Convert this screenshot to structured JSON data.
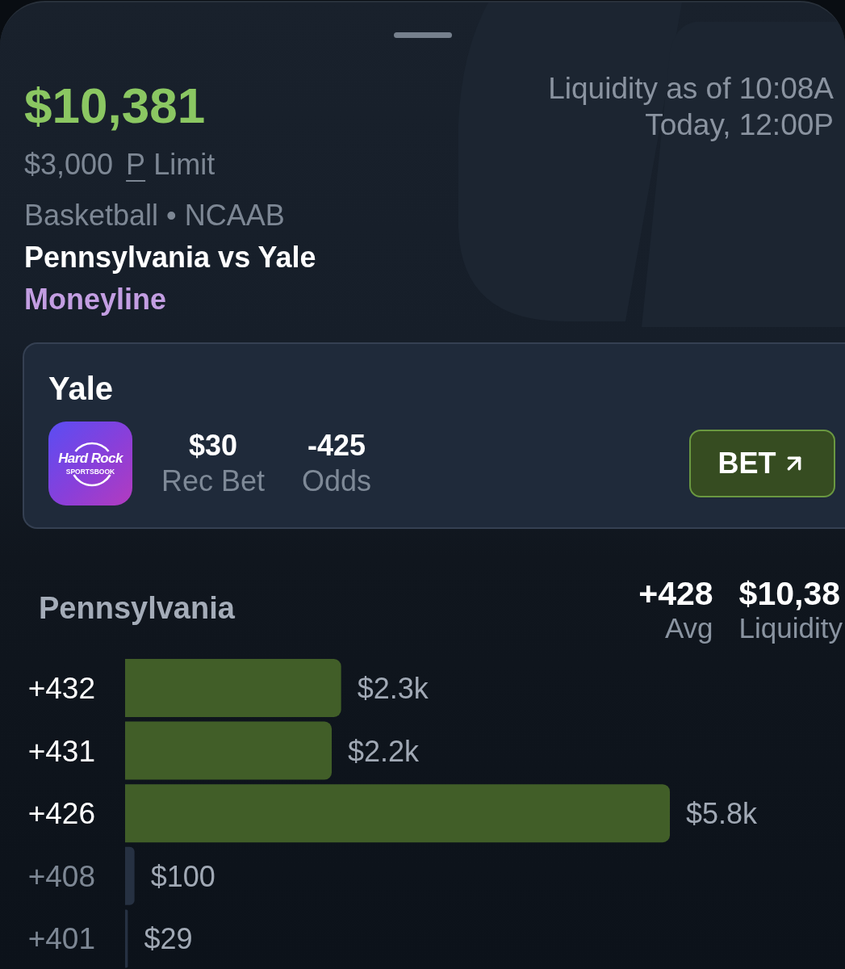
{
  "summary": {
    "total_liquidity": "$10,381",
    "limit": {
      "amount": "$3,000",
      "book_letter": "P",
      "label": "Limit"
    },
    "sport_league": "Basketball • NCAAB",
    "matchup": "Pennsylvania vs Yale",
    "market": "Moneyline",
    "updated": "Liquidity as of 10:08A",
    "start_time": "Today, 12:00P"
  },
  "bet_card": {
    "team": "Yale",
    "sportsbook": {
      "wordmark": "Hard Rock",
      "tagline": "SPORTSBOOK"
    },
    "stats": [
      {
        "value": "$30",
        "label": "Rec Bet"
      },
      {
        "value": "-425",
        "label": "Odds"
      }
    ],
    "button": {
      "label": "BET"
    }
  },
  "ladder": {
    "team": "Pennsylvania",
    "stats": [
      {
        "value": "+428",
        "label": "Avg"
      },
      {
        "value": "$10,38",
        "label": "Liquidity"
      }
    ],
    "rows": [
      {
        "highlighted": true
      },
      {
        "highlighted": true
      },
      {
        "highlighted": true
      },
      {
        "highlighted": false
      },
      {
        "highlighted": false
      }
    ],
    "chart_data": {
      "type": "bar",
      "orientation": "horizontal",
      "categories": [
        "+432",
        "+431",
        "+426",
        "+408",
        "+401"
      ],
      "series": [
        {
          "color": "#415e28",
          "values": [
            2300,
            2200,
            5800,
            null,
            null
          ],
          "value_labels": [
            "$2.3k",
            "$2.2k",
            "$5.8k",
            null,
            null
          ]
        },
        {
          "color": "#263142",
          "values": [
            null,
            null,
            null,
            100,
            29
          ],
          "value_labels": [
            null,
            null,
            null,
            "$100",
            "$29"
          ]
        }
      ]
    }
  }
}
